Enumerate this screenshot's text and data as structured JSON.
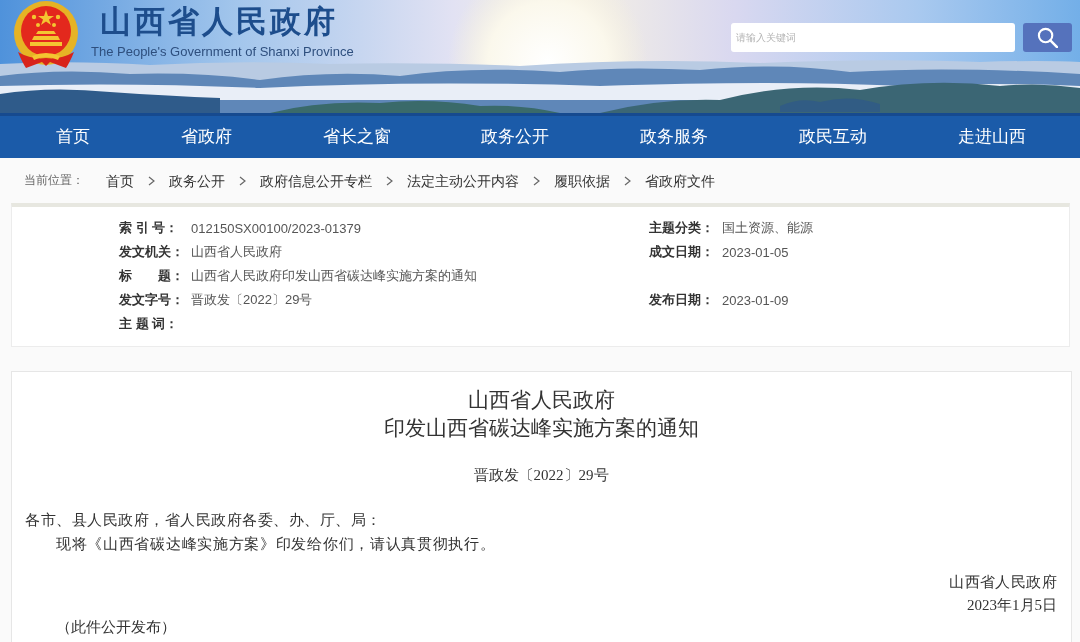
{
  "header": {
    "title": "山西省人民政府",
    "subtitle": "The People's Government of Shanxi Province",
    "search": {
      "placeholder": "请输入关键词"
    }
  },
  "nav": {
    "items": [
      {
        "label": "首页"
      },
      {
        "label": "省政府"
      },
      {
        "label": "省长之窗"
      },
      {
        "label": "政务公开"
      },
      {
        "label": "政务服务"
      },
      {
        "label": "政民互动"
      },
      {
        "label": "走进山西"
      }
    ]
  },
  "breadcrumb": {
    "label": "当前位置：",
    "items": [
      "首页",
      "政务公开",
      "政府信息公开专栏",
      "法定主动公开内容",
      "履职依据",
      "省政府文件"
    ]
  },
  "metadata": {
    "rows": [
      {
        "fields": [
          {
            "label": "索 引 号：",
            "value": "012150SX00100/2023-01379"
          },
          {
            "label": "主题分类：",
            "value": "国土资源、能源"
          }
        ]
      },
      {
        "fields": [
          {
            "label": "发文机关：",
            "value": "山西省人民政府"
          },
          {
            "label": "成文日期：",
            "value": "2023-01-05"
          }
        ]
      },
      {
        "fields": [
          {
            "label": "标　　题：",
            "value": "山西省人民政府印发山西省碳达峰实施方案的通知"
          }
        ]
      },
      {
        "fields": [
          {
            "label": "发文字号：",
            "value": "晋政发〔2022〕29号"
          },
          {
            "label": "发布日期：",
            "value": "2023-01-09"
          }
        ]
      },
      {
        "fields": [
          {
            "label": "主 题 词："
          }
        ]
      }
    ]
  },
  "document": {
    "title_lines": [
      "山西省人民政府",
      "印发山西省碳达峰实施方案的通知"
    ],
    "doc_number": "晋政发〔2022〕29号",
    "salutation": "各市、县人民政府，省人民政府各委、办、厅、局：",
    "body": [
      "现将《山西省碳达峰实施方案》印发给你们，请认真贯彻执行。"
    ],
    "signature": "山西省人民政府",
    "date": "2023年1月5日",
    "note": "（此件公开发布）"
  }
}
